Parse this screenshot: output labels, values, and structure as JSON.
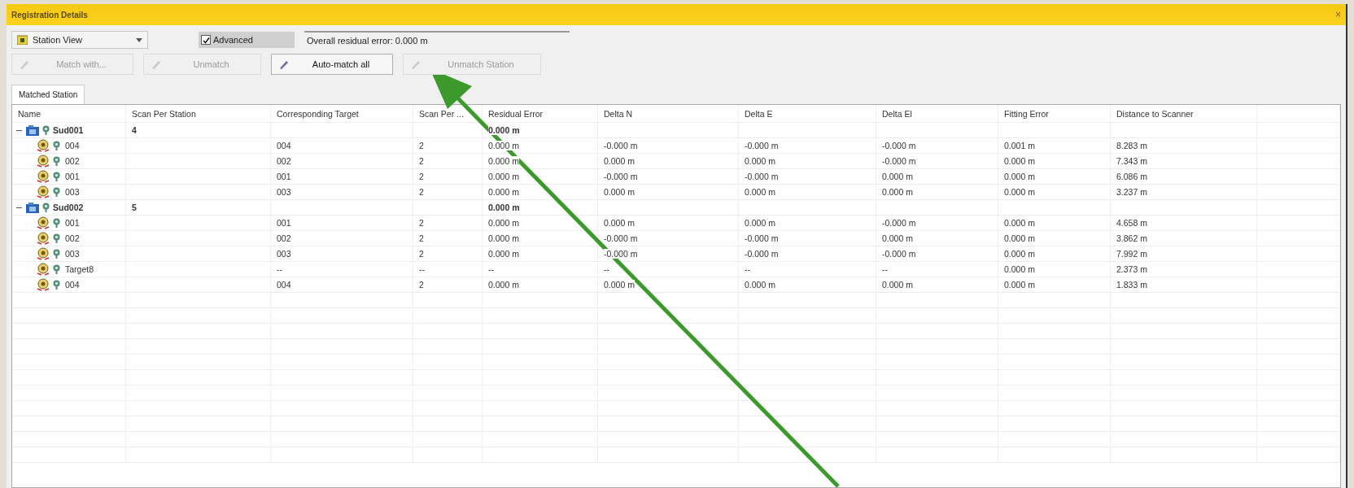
{
  "window": {
    "title": "Registration Details",
    "close": "×"
  },
  "toolbar": {
    "view_select": {
      "value": "Station View"
    },
    "advanced": {
      "label": "Advanced",
      "checked": true
    },
    "residual_field": {
      "value": "Overall residual error: 0.000 m"
    },
    "buttons": [
      {
        "label": "Match with...",
        "disabled": true
      },
      {
        "label": "Unmatch",
        "disabled": true
      },
      {
        "label": "Auto-match all",
        "disabled": false
      },
      {
        "label": "Unmatch Station",
        "disabled": true
      }
    ]
  },
  "tabs": [
    {
      "label": "Matched Station",
      "selected": true
    }
  ],
  "table": {
    "columns": [
      "Name",
      "Scan Per Station",
      "Corresponding Target",
      "Scan Per ...",
      "Residual Error",
      "Delta N",
      "Delta E",
      "Delta El",
      "Fitting Error",
      "Distance to Scanner"
    ],
    "rows": [
      {
        "name": "Sud001",
        "expanded": true,
        "scan_per_station": "4",
        "residual_error": "0.000 m",
        "children": [
          {
            "name": "004",
            "corresponding_target": "004",
            "scan_per": "2",
            "residual_error": "0.000 m",
            "delta_n": "-0.000 m",
            "delta_e": "-0.000 m",
            "delta_el": "-0.000 m",
            "fitting_error": "0.001 m",
            "distance": "8.283 m"
          },
          {
            "name": "002",
            "corresponding_target": "002",
            "scan_per": "2",
            "residual_error": "0.000 m",
            "delta_n": "0.000 m",
            "delta_e": "0.000 m",
            "delta_el": "-0.000 m",
            "fitting_error": "0.000 m",
            "distance": "7.343 m"
          },
          {
            "name": "001",
            "corresponding_target": "001",
            "scan_per": "2",
            "residual_error": "0.000 m",
            "delta_n": "-0.000 m",
            "delta_e": "-0.000 m",
            "delta_el": "0.000 m",
            "fitting_error": "0.000 m",
            "distance": "6.086 m"
          },
          {
            "name": "003",
            "corresponding_target": "003",
            "scan_per": "2",
            "residual_error": "0.000 m",
            "delta_n": "0.000 m",
            "delta_e": "0.000 m",
            "delta_el": "0.000 m",
            "fitting_error": "0.000 m",
            "distance": "3.237 m"
          }
        ]
      },
      {
        "name": "Sud002",
        "expanded": true,
        "scan_per_station": "5",
        "residual_error": "0.000 m",
        "children": [
          {
            "name": "001",
            "corresponding_target": "001",
            "scan_per": "2",
            "residual_error": "0.000 m",
            "delta_n": "0.000 m",
            "delta_e": "0.000 m",
            "delta_el": "-0.000 m",
            "fitting_error": "0.000 m",
            "distance": "4.658 m"
          },
          {
            "name": "002",
            "corresponding_target": "002",
            "scan_per": "2",
            "residual_error": "0.000 m",
            "delta_n": "-0.000 m",
            "delta_e": "-0.000 m",
            "delta_el": "0.000 m",
            "fitting_error": "0.000 m",
            "distance": "3.862 m"
          },
          {
            "name": "003",
            "corresponding_target": "003",
            "scan_per": "2",
            "residual_error": "0.000 m",
            "delta_n": "-0.000 m",
            "delta_e": "-0.000 m",
            "delta_el": "-0.000 m",
            "fitting_error": "0.000 m",
            "distance": "7.992 m"
          },
          {
            "name": "Target8",
            "corresponding_target": "--",
            "scan_per": "--",
            "residual_error": "--",
            "delta_n": "--",
            "delta_e": "--",
            "delta_el": "--",
            "fitting_error": "0.000 m",
            "distance": "2.373 m"
          },
          {
            "name": "004",
            "corresponding_target": "004",
            "scan_per": "2",
            "residual_error": "0.000 m",
            "delta_n": "0.000 m",
            "delta_e": "0.000 m",
            "delta_el": "0.000 m",
            "fitting_error": "0.000 m",
            "distance": "1.833 m"
          }
        ]
      }
    ]
  },
  "annotation": {
    "kind": "arrow"
  }
}
